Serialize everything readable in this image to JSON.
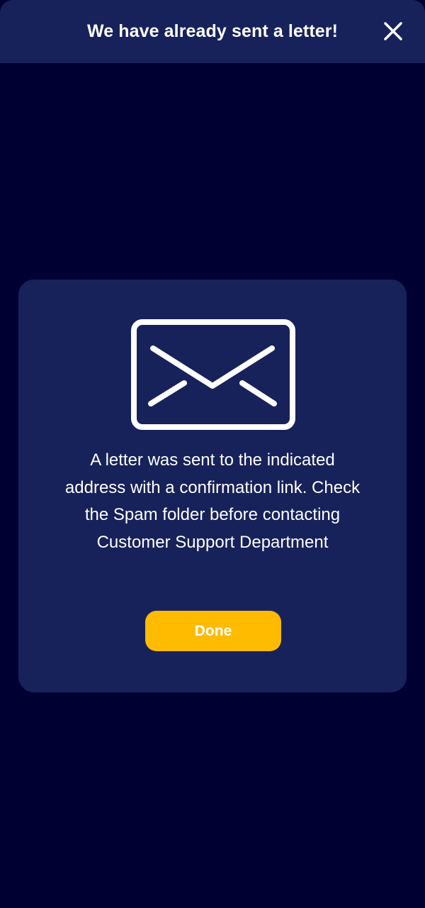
{
  "header": {
    "title": "We have already sent a letter!",
    "close_icon": "close-icon"
  },
  "dialog": {
    "icon": "envelope-icon",
    "message": "A letter was sent to the indicated address with a confirmation link. Check the Spam folder before contacting Customer Support Department",
    "done_label": "Done"
  },
  "colors": {
    "background": "#000033",
    "panel": "#17225b",
    "accent": "#ffbb00",
    "text": "#ffffff"
  }
}
